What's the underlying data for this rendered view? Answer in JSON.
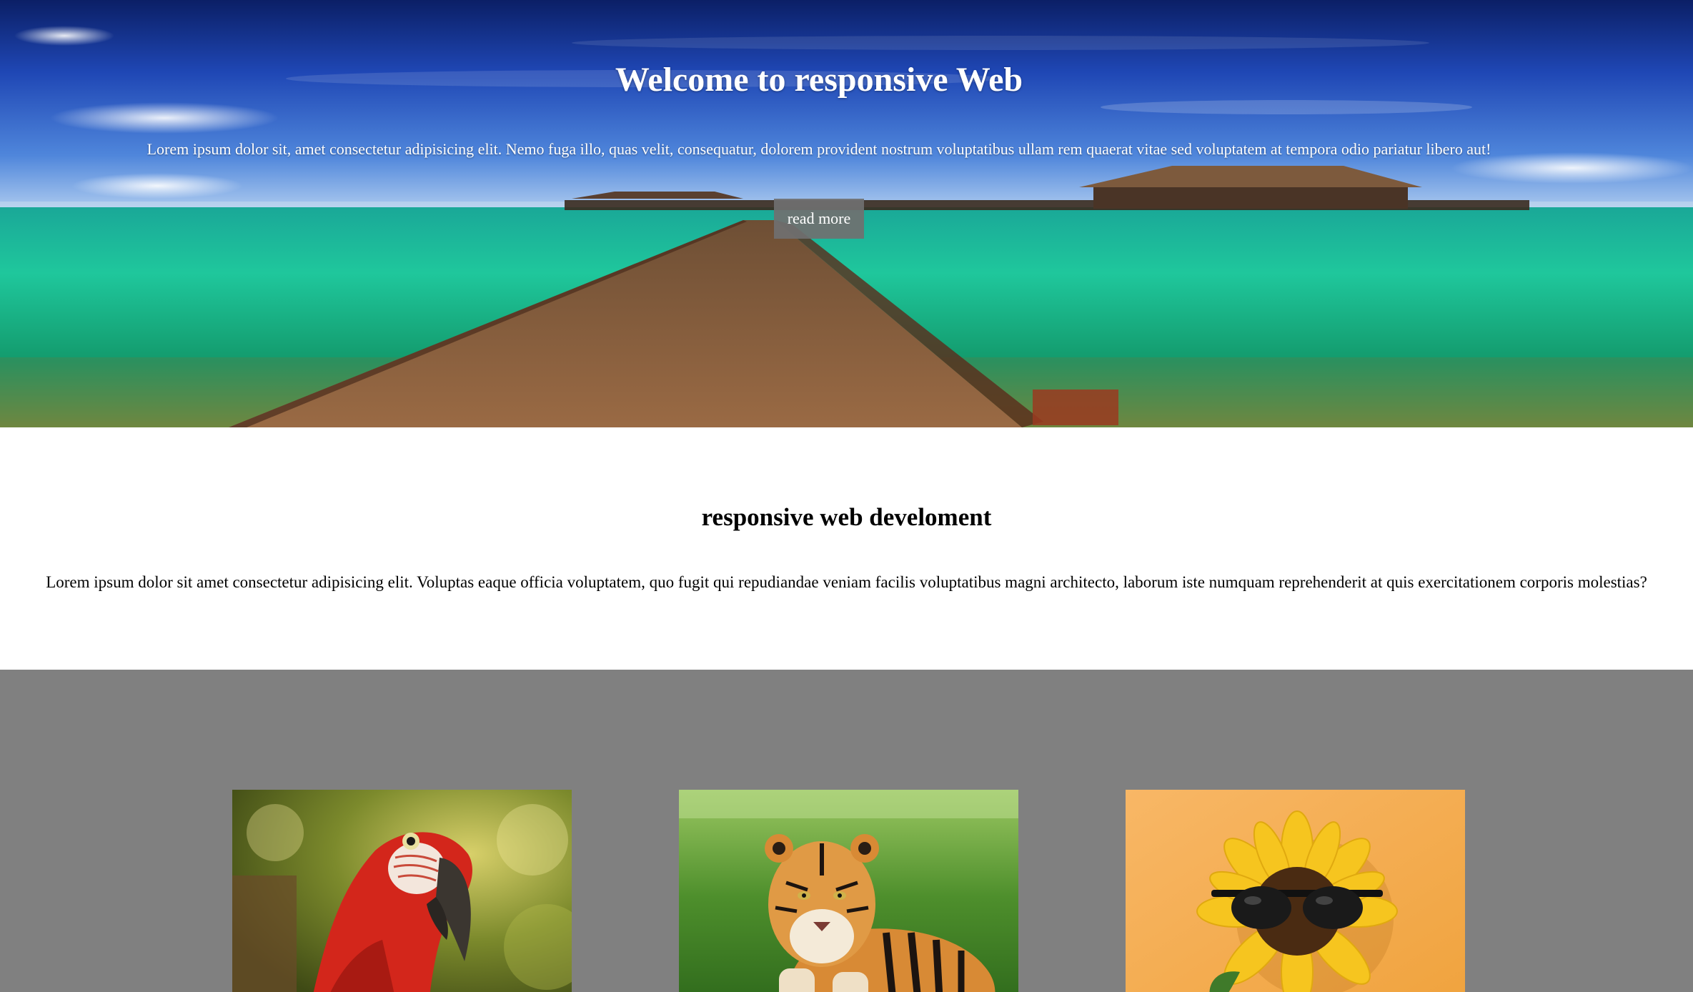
{
  "hero": {
    "title": "Welcome to responsive Web",
    "text": "Lorem ipsum dolor sit, amet consectetur adipisicing elit. Nemo fuga illo, quas velit, consequatur, dolorem provident nostrum voluptatibus ullam rem quaerat vitae sed voluptatem at tempora odio pariatur libero aut!",
    "button_label": "read more"
  },
  "intro": {
    "title": "responsive web develoment",
    "text": "Lorem ipsum dolor sit amet consectetur adipisicing elit. Voluptas eaque officia voluptatem, quo fugit qui repudiandae veniam facilis voluptatibus magni architecto, laborum iste numquam reprehenderit at quis exercitationem corporis molestias?"
  },
  "gallery": {
    "background": "#808080",
    "images": [
      {
        "subject": "parrot-image"
      },
      {
        "subject": "tiger-image"
      },
      {
        "subject": "sunflower-with-sunglasses-image"
      }
    ]
  }
}
